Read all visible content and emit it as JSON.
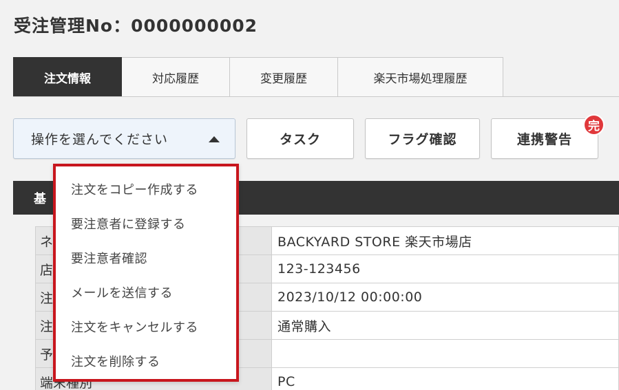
{
  "page": {
    "title": "受注管理No：0000000002"
  },
  "tabs": [
    {
      "label": "注文情報",
      "active": true
    },
    {
      "label": "対応履歴",
      "active": false
    },
    {
      "label": "変更履歴",
      "active": false
    },
    {
      "label": "楽天市場処理履歴",
      "active": false
    }
  ],
  "toolbar": {
    "operation_select": {
      "value": "操作を選んでください"
    },
    "task_label": "タスク",
    "flag_label": "フラグ確認",
    "warning_label": "連携警告",
    "warning_badge": "完"
  },
  "dropdown": {
    "items": [
      "注文をコピー作成する",
      "要注意者に登録する",
      "要注意者確認",
      "メールを送信する",
      "注文をキャンセルする",
      "注文を削除する"
    ]
  },
  "section": {
    "title": "基"
  },
  "info_rows": [
    {
      "label": "ネ",
      "value": "BACKYARD STORE 楽天市場店"
    },
    {
      "label": "店",
      "value": "123-123456"
    },
    {
      "label": "注",
      "value": "2023/10/12 00:00:00"
    },
    {
      "label": "注",
      "value": "通常購入"
    },
    {
      "label": "予",
      "value": ""
    },
    {
      "label": "端末種別",
      "value": "PC"
    }
  ],
  "colors": {
    "accent_border": "#c8161d",
    "badge": "#e0383b",
    "dark": "#333333"
  }
}
